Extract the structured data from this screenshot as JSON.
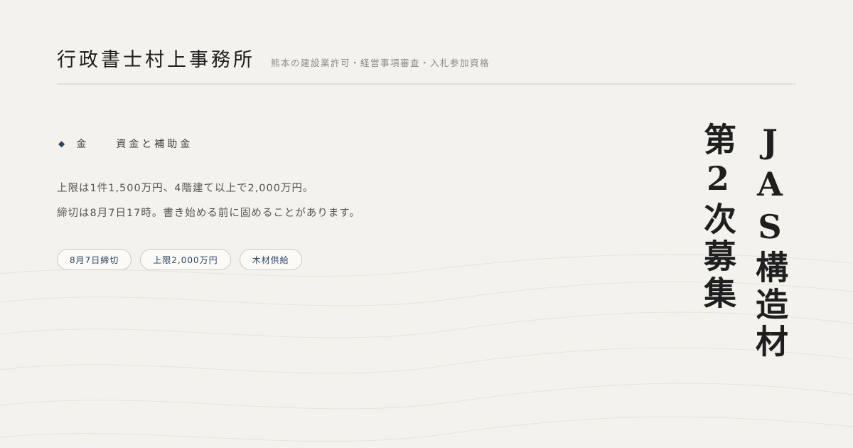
{
  "header": {
    "brand": "行政書士村上事務所",
    "tagline": "熊本の建設業許可・経営事項審査・入札参加資格"
  },
  "category": {
    "icon": "diamond-icon",
    "main": "金",
    "sub": "資金と補助金"
  },
  "body": {
    "line1": "上限は1件1,500万円、4階建て以上で2,000万円。",
    "line2": "締切は8月7日17時。書き始める前に固めることがあります。"
  },
  "tags": [
    "8月7日締切",
    "上限2,000万円",
    "木材供給"
  ],
  "title": {
    "column1": "JAS構造材",
    "column2": "第2次募集"
  },
  "colors": {
    "background": "#f4f2ed",
    "accent": "#2c4566",
    "text": "#1f1f1f"
  }
}
